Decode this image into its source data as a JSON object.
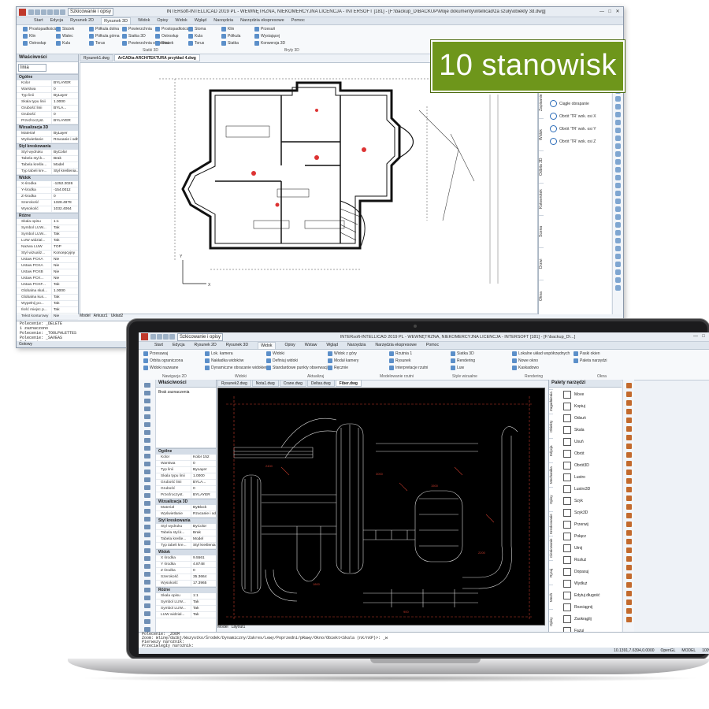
{
  "badge": {
    "text": "10 stanowisk",
    "color": "#6e961b"
  },
  "back": {
    "title": "INTERsoft-INTELLICAD 2019 PL - WEWNĘTRZNA, NIEKOMERCYJNA LICENCJA - INTERSOFT [181] - [F:\\backup_D\\BACKUP\\Moje dokumenty\\intellicad\\za szuły\\obiekty 3d.dwg]",
    "qat_combo": "Szkicowanie i opisy",
    "tabs": [
      "Start",
      "Edycja",
      "Rysunek 2D",
      "Rysunek 3D",
      "Widok",
      "Opisy",
      "Widok",
      "Wgląd",
      "Narzędzia",
      "Narzędzia ekspresowe",
      "Pomoc"
    ],
    "ribbon": {
      "labels": [
        "Prostopadłościan",
        "Klin",
        "Ostrosłup",
        "Stożek",
        "Walec",
        "Kula",
        "Półkula dolna",
        "Półkula górna",
        "Torus",
        "Powierzchnia",
        "Siatka 3D",
        "Powierzchnia obrotowa",
        "Prostopadłościan",
        "Ostrosłup",
        "Stożek",
        "Stoma",
        "Kula",
        "Torus",
        "Klin",
        "Półkula",
        "Siatka",
        "Przesuń",
        "Wystającej",
        "Konwersja 3D"
      ],
      "group": "Siatki 3D",
      "group2": "Bryły 3D"
    },
    "panel_title": "Właściwości",
    "combo": "linia",
    "sections": [
      {
        "name": "Ogólne",
        "rows": [
          [
            "Kolor",
            "BYLAYER"
          ],
          [
            "Warstwa",
            "0"
          ],
          [
            "Typ linii",
            "ByLayer"
          ],
          [
            "Skala typu linii",
            "1.0000"
          ],
          [
            "Grubość linii",
            "BYLA..."
          ],
          [
            "Grubość",
            "0"
          ],
          [
            "Przeźroczyst.",
            "BYLAYER"
          ]
        ]
      },
      {
        "name": "Wizualizacja 3D",
        "rows": [
          [
            "Materiał",
            "ByLayer"
          ],
          [
            "Wyświetlanie",
            "Rzucanie i odb..."
          ]
        ]
      },
      {
        "name": "Styl kreskowania",
        "rows": [
          [
            "Styl wydruku",
            "ByColor"
          ],
          [
            "Tabela styl.k...",
            "Brak"
          ],
          [
            "Tabela kreśle...",
            "Model"
          ],
          [
            "Typ tabeli kre...",
            "Styl kreślenia..."
          ]
        ]
      },
      {
        "name": "Widok",
        "rows": [
          [
            "X-środka",
            "-1252.2026"
          ],
          [
            "Y-środka",
            "-154.0012"
          ],
          [
            "Z-środka",
            "0"
          ],
          [
            "Szerokość",
            "1328.4878"
          ],
          [
            "Wysokość",
            "1032.4064"
          ]
        ]
      },
      {
        "name": "Różne",
        "rows": [
          [
            "Skala opisu",
            "1:1"
          ],
          [
            "Symbol LUW...",
            "Tak"
          ],
          [
            "Symbol LUW...",
            "Tak"
          ],
          [
            "LUW widzial...",
            "Tak"
          ],
          [
            "Nazwa LUW",
            "TOP"
          ],
          [
            "Styl wizualiz...",
            "Koncepcyjny"
          ],
          [
            "Ustaw PCKA",
            "Nie"
          ],
          [
            "Ustaw PCKA",
            "Nie"
          ],
          [
            "Ustaw PCKB",
            "Nie"
          ],
          [
            "Ustaw PCK...",
            "Nie"
          ],
          [
            "Ustaw PCKF...",
            "Tak"
          ],
          [
            "Globalna skal...",
            "1.0000"
          ],
          [
            "Globalna kus...",
            "Tak"
          ],
          [
            "Wypełnij po...",
            "Tak"
          ],
          [
            "Ilość miejsc p...",
            "Tak"
          ],
          [
            "Tekst konturowy",
            "Nie"
          ]
        ]
      }
    ],
    "doc_tabs": [
      "Rysunek1.dwg",
      "ArCADia-ARCHITEKTURA przykład 4.dwg"
    ],
    "vtabs": [
      "Zapisanie",
      "Widok",
      "Odbita 3D",
      "Kołowrotek",
      "Scena",
      "Drzwi",
      "Okna"
    ],
    "rpanel_items": [
      "Ciągłe obrapanie",
      "Obrót 'TR' wok. osi X",
      "Obrót 'TR' wok. osi Y",
      "Obrót 'TR' wok. osi Z"
    ],
    "layout_tabs": [
      "Model",
      "Arkusz1",
      "Układ2"
    ],
    "cmd_lines": [
      "Polecenie: _DELETE",
      "1 zaznaczono",
      "Polecenie: _TOOLPALETTES",
      "Polecenie: _SAVEAS",
      "Polecenie:"
    ],
    "status": "Gotowy"
  },
  "front": {
    "title": "INTERsoft-INTELLICAD 2019 PL - WEWNĘTRZNA, NIEKOMERCYJNA LICENCJA - INTERSOFT [181] - [F:\\backup_D\\...]",
    "qat_combo": "Szkicowanie i opisy",
    "tabs": [
      "Start",
      "Edycja",
      "Rysunek 2D",
      "Rysunek 3D",
      "Widok",
      "Opisy",
      "Wstaw",
      "Wgląd",
      "Narzędzia",
      "Narzędzia ekspresowe",
      "Pomoc"
    ],
    "active_tab": "Widok",
    "ribbon": {
      "labels": [
        "Przesuwaj",
        "Orbita ograniczona",
        "Widoki nazwane",
        "Lok. kamera",
        "Nakładka widoków",
        "Dynamiczne obracanie widokiem",
        "Widoki",
        "Definiuj widoki",
        "Standardowe punkty obserwacji",
        "Widok z góry",
        "Moduł kamery",
        "Ręcznie",
        "Rzutnia 1",
        "Rysunek",
        "Interpretacje rzutni",
        "Siatka 3D",
        "Rendering",
        "Luw",
        "Lokalne układ współrzędnych",
        "Nowe okno",
        "Kaskadowo",
        "Paski okien",
        "Paleta narzędzi"
      ],
      "groups": [
        "Nawigacja 2D",
        "Widoki",
        "Aktualizuj",
        "Modelowanie rzutni",
        "Style wizualne",
        "Rendering",
        "Okna"
      ]
    },
    "panel_title": "Właściwości",
    "list_item": "Brak zaznaczenia",
    "sections": [
      {
        "name": "Ogólne",
        "rows": [
          [
            "Kolor",
            "Kolor 152"
          ],
          [
            "Warstwa",
            "0"
          ],
          [
            "Typ linii",
            "ByLayer"
          ],
          [
            "Skala typu linii",
            "1.0000"
          ],
          [
            "Grubość linii",
            "BYLA..."
          ],
          [
            "Grubość",
            "0"
          ],
          [
            "Przeźroczyst.",
            "BYLAYER"
          ]
        ]
      },
      {
        "name": "Wizualizacja 3D",
        "rows": [
          [
            "Materiał",
            "ByBlock"
          ],
          [
            "Wyświetlanie",
            "Rzucanie i odb..."
          ]
        ]
      },
      {
        "name": "Styl kreskowania",
        "rows": [
          [
            "Styl wydruku",
            "ByColor"
          ],
          [
            "Tabela styl.k...",
            "Brak"
          ],
          [
            "Tabela kreśle...",
            "Model"
          ],
          [
            "Typ tabeli kre...",
            "Styl kreślenia"
          ]
        ]
      },
      {
        "name": "Widok",
        "rows": [
          [
            "X środka",
            "9.5561"
          ],
          [
            "Y środka",
            "4.8748"
          ],
          [
            "Z środka",
            "0"
          ],
          [
            "Szerokość",
            "35.3664"
          ],
          [
            "Wysokość",
            "17.3965"
          ]
        ]
      },
      {
        "name": "Różne",
        "rows": [
          [
            "Skala opisu",
            "1:1"
          ],
          [
            "Symbol LUW...",
            "Tak"
          ],
          [
            "Symbol LUW...",
            "Tak"
          ],
          [
            "LUW widzial...",
            "Tak"
          ]
        ]
      }
    ],
    "doc_tabs": [
      "Rysunek2.dwg",
      "Nota1.dwg",
      "Crane.dwg",
      "Deltas.dwg",
      "Fiber.dwg"
    ],
    "layout_tabs": [
      "Model",
      "Layout1"
    ],
    "palette_title": "Palety narzędzi",
    "palette_items": [
      "Move",
      "Kopiuj",
      "Odsuń",
      "Skala",
      "Usuń",
      "Obrót",
      "Obrót3D",
      "Lustro",
      "Lustro3D",
      "Szyk",
      "Szyk3D",
      "Przerwij",
      "Połącz",
      "Utnij",
      "Rozłuż",
      "Dopasuj",
      "Wydłuż",
      "Edytuj długość",
      "Rozciągnij",
      "Zaokrąglij",
      "Fazuj"
    ],
    "palette_tabs": [
      "Zagadnienia",
      "Obiekty",
      "Edycja",
      "Mechanika",
      "Opisy",
      "Kreskowanie",
      "Cieniowanie",
      "Rysuj",
      "Mech",
      "Opisy"
    ],
    "cmd_lines": [
      "Polecenie: _ZOOM",
      "Zoom: Wlinę/daIEj/Wszystko/Środek/Dynamiczny/Zakres/Lewy/Poprzedni/pRawy/Okno/Obiekt<Skala (nX/nXP)>: _w",
      "Pierwszy narożnik:",
      "Przeciwległy narożnik:",
      "Polecenie:"
    ],
    "status": [
      "10.1391,7.6394,0.0000",
      "OpenGL",
      "MODEL",
      "100%"
    ]
  }
}
